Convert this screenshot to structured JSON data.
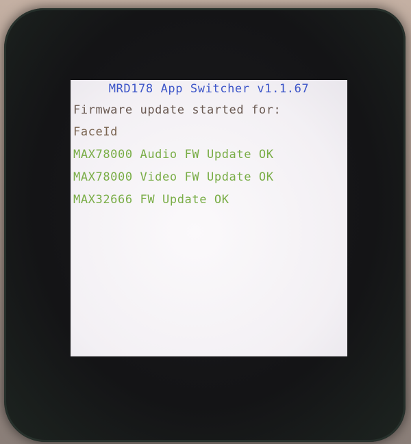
{
  "screen": {
    "title": "MRD178 App Switcher v1.1.67",
    "lines": [
      {
        "text": "Firmware update started for:",
        "color": "#6a5a52"
      },
      {
        "text": "FaceId",
        "color": "#7a6450"
      },
      {
        "text": "MAX78000 Audio FW Update OK",
        "color": "#79ad46"
      },
      {
        "text": "MAX78000 Video FW Update OK",
        "color": "#79ad46"
      },
      {
        "text": "MAX32666 FW Update OK",
        "color": "#79ad46"
      }
    ],
    "title_color": "#3c55c8"
  }
}
